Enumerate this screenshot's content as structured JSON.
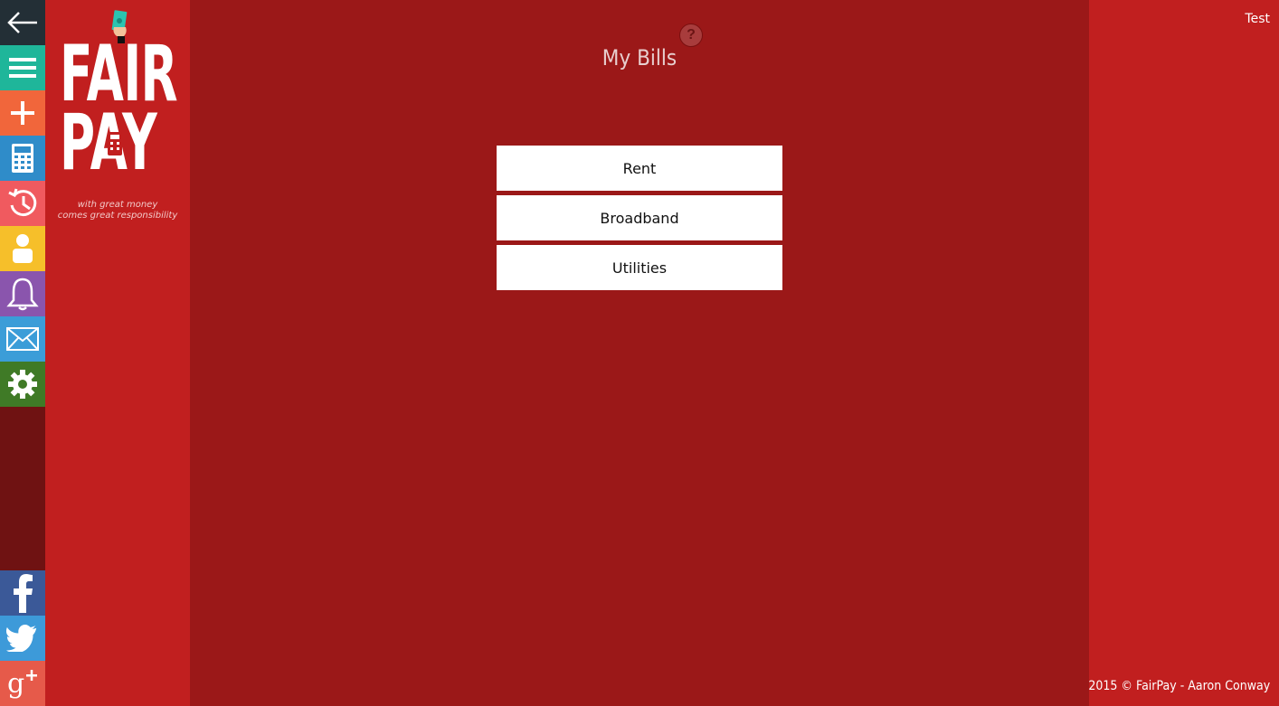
{
  "sidebar": {
    "items": [
      {
        "name": "back",
        "icon": "arrow-left-icon",
        "color": "#232f36"
      },
      {
        "name": "menu",
        "icon": "hamburger-icon",
        "color": "#1fb69a"
      },
      {
        "name": "add",
        "icon": "plus-icon",
        "color": "#f1663b"
      },
      {
        "name": "calculator",
        "icon": "calculator-icon",
        "color": "#2f8cc9"
      },
      {
        "name": "history",
        "icon": "clock-history-icon",
        "color": "#f05a5f"
      },
      {
        "name": "profile",
        "icon": "person-icon",
        "color": "#f6bf2a"
      },
      {
        "name": "notifications",
        "icon": "bell-icon",
        "color": "#8a55ad"
      },
      {
        "name": "messages",
        "icon": "envelope-icon",
        "color": "#3b9dd8"
      },
      {
        "name": "settings",
        "icon": "gear-icon",
        "color": "#3f7a26"
      }
    ],
    "social": [
      {
        "name": "facebook",
        "icon": "facebook-icon",
        "color": "#3b5998"
      },
      {
        "name": "twitter",
        "icon": "twitter-icon",
        "color": "#3d9ad9"
      },
      {
        "name": "google-plus",
        "icon": "google-plus-icon",
        "color": "#e65a4a"
      }
    ]
  },
  "logo": {
    "line1": "FAIR",
    "line2": "PAY",
    "tagline1": "with great money",
    "tagline2": "comes great responsibility"
  },
  "header": {
    "help_label": "?",
    "title": "My Bills"
  },
  "bills": [
    {
      "label": "Rent"
    },
    {
      "label": "Broadband"
    },
    {
      "label": "Utilities"
    }
  ],
  "user": {
    "name": "Test"
  },
  "footer": {
    "text": "2015 © FairPay - Aaron Conway"
  },
  "colors": {
    "main_bg": "#9b1818",
    "side_bg": "#c11f1f",
    "rail_bg": "#6f1212"
  }
}
